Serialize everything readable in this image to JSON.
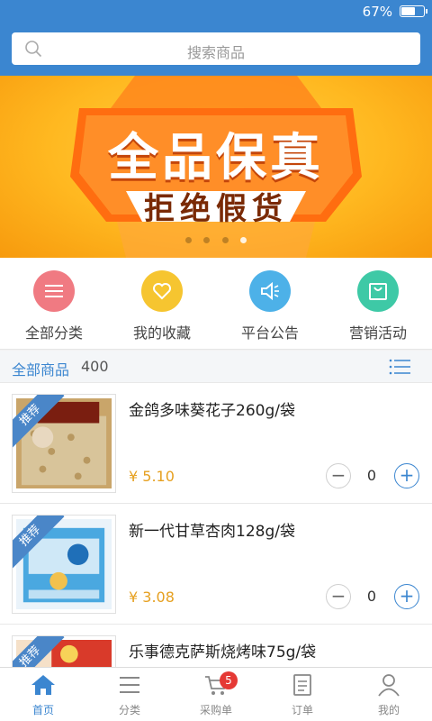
{
  "status_bar": {
    "battery_text": "67%",
    "battery_level": 0.67
  },
  "search": {
    "placeholder": "搜索商品"
  },
  "banner": {
    "title": "全品保真",
    "subtitle": "拒绝假货",
    "slide_count": 4,
    "active_slide": 4
  },
  "quick_links": [
    {
      "label": "全部分类",
      "icon": "list-icon",
      "color": "#f07a82"
    },
    {
      "label": "我的收藏",
      "icon": "heart-icon",
      "color": "#f6c530"
    },
    {
      "label": "平台公告",
      "icon": "megaphone-icon",
      "color": "#4db1e8"
    },
    {
      "label": "营销活动",
      "icon": "shopping-bag-icon",
      "color": "#3ec9a6"
    }
  ],
  "list_header": {
    "title": "全部商品",
    "count": "400"
  },
  "products": [
    {
      "name": "金鸽多味葵花子260g/袋",
      "price": "¥ 5.10",
      "qty": "0",
      "tag": "推荐"
    },
    {
      "name": "新一代甘草杏肉128g/袋",
      "price": "¥ 3.08",
      "qty": "0",
      "tag": "推荐"
    },
    {
      "name": "乐事德克萨斯烧烤味75g/袋",
      "price": "",
      "qty": "",
      "tag": "推荐"
    }
  ],
  "tabbar": {
    "items": [
      {
        "label": "首页",
        "icon": "home-icon",
        "active": true
      },
      {
        "label": "分类",
        "icon": "menu-icon",
        "active": false
      },
      {
        "label": "采购单",
        "icon": "cart-icon",
        "active": false,
        "badge": "5"
      },
      {
        "label": "订单",
        "icon": "order-icon",
        "active": false
      },
      {
        "label": "我的",
        "icon": "user-icon",
        "active": false
      }
    ]
  },
  "colors": {
    "brand": "#3b86d0",
    "price": "#e6a020",
    "badge": "#e53935"
  }
}
